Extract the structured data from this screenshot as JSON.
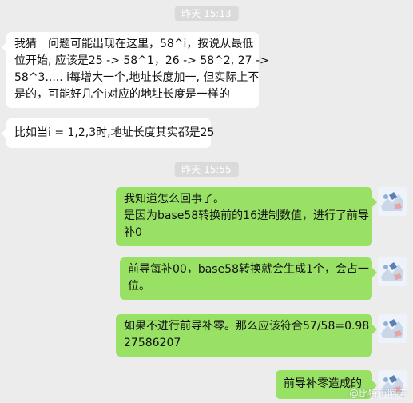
{
  "timestamps": [
    "昨天 15:13",
    "昨天 15:55"
  ],
  "incoming": [
    {
      "lines": [
        "我猜　问题可能出现在这里，58^i，按说从最低",
        "位开始, 应该是25 -> 58^1，26 -> 58^2, 27 ->",
        "58^3.....  i每增大一个,地址长度加一, 但实际上不",
        "是的，可能好几个i对应的地址长度是一样的"
      ]
    },
    {
      "lines": [
        "比如当i = 1,2,3时,地址长度其实都是25"
      ]
    }
  ],
  "outgoing": [
    {
      "lines": [
        "我知道怎么回事了。",
        "是因为base58转换前的16进制数值，进行了前导",
        "补0"
      ]
    },
    {
      "lines": [
        "前导每补00，base58转换就会生成1个，会占一",
        "位。"
      ]
    },
    {
      "lines": [
        "如果不进行前导补零。那么应该符合57/58=0.98",
        "27586207"
      ]
    },
    {
      "lines": [
        "前导补零造成的"
      ]
    }
  ],
  "watermark": "@比特币阿诺"
}
